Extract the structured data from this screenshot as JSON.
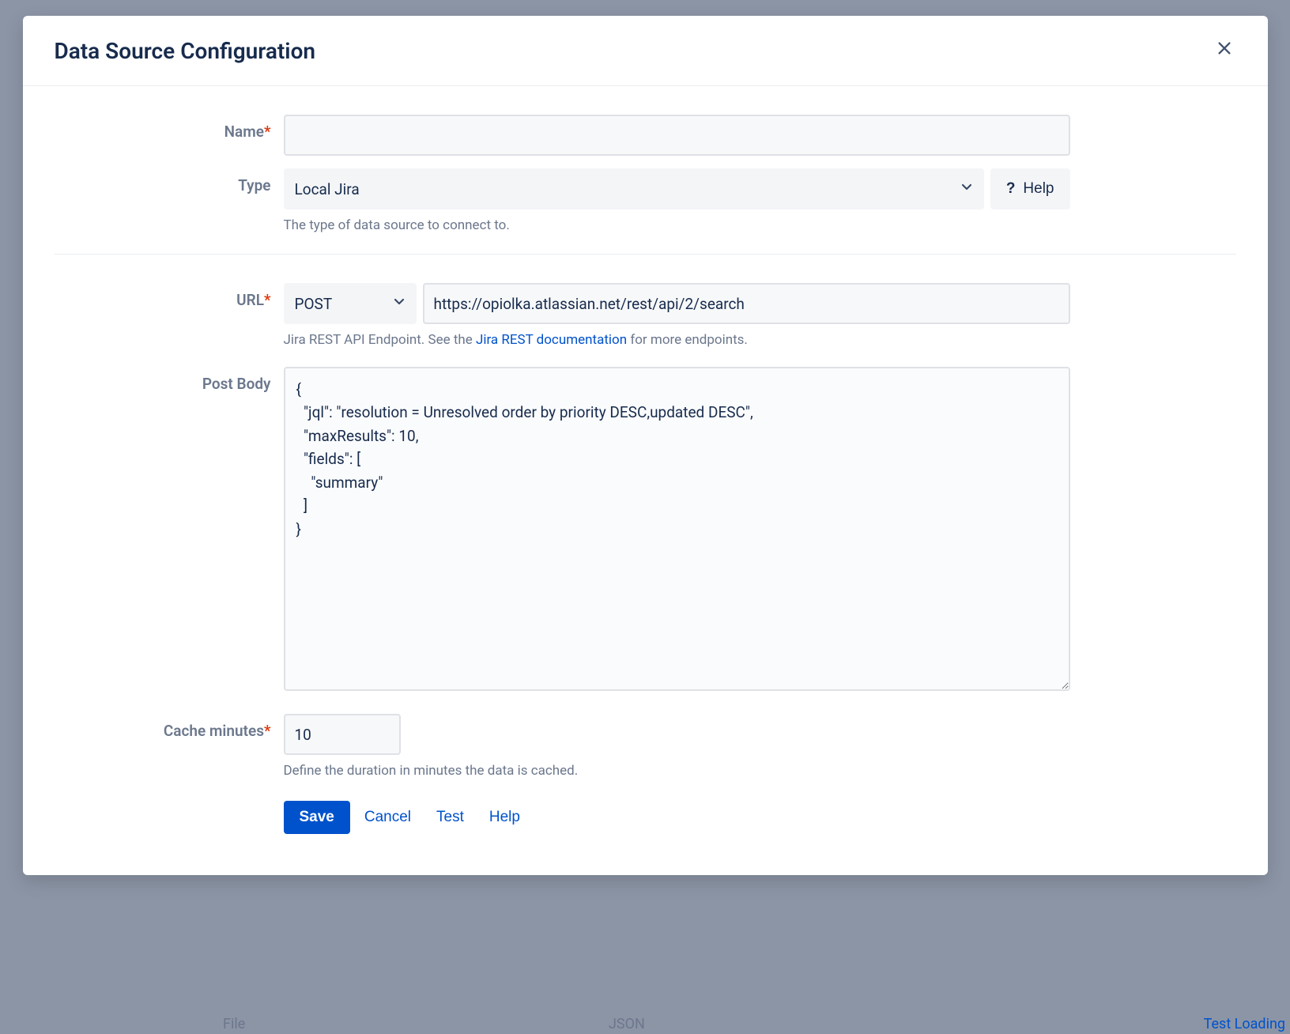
{
  "modal": {
    "title": "Data Source Configuration"
  },
  "fields": {
    "name": {
      "label": "Name",
      "value": ""
    },
    "type": {
      "label": "Type",
      "value": "Local Jira",
      "help_button": "Help",
      "help_text": "The type of data source to connect to."
    },
    "url": {
      "label": "URL",
      "method": "POST",
      "value": "https://opiolka.atlassian.net/rest/api/2/search",
      "help_prefix": "Jira REST API Endpoint. See the ",
      "help_link": "Jira REST documentation",
      "help_suffix": " for more endpoints."
    },
    "post_body": {
      "label": "Post Body",
      "value": "{\n  \"jql\": \"resolution = Unresolved order by priority DESC,updated DESC\",\n  \"maxResults\": 10,\n  \"fields\": [\n    \"summary\"\n  ]\n}"
    },
    "cache": {
      "label": "Cache minutes",
      "value": "10",
      "help_text": "Define the duration in minutes the data is cached."
    }
  },
  "buttons": {
    "save": "Save",
    "cancel": "Cancel",
    "test": "Test",
    "help": "Help"
  },
  "background": {
    "file": "File",
    "json": "JSON",
    "test_loading": "Test Loading"
  }
}
